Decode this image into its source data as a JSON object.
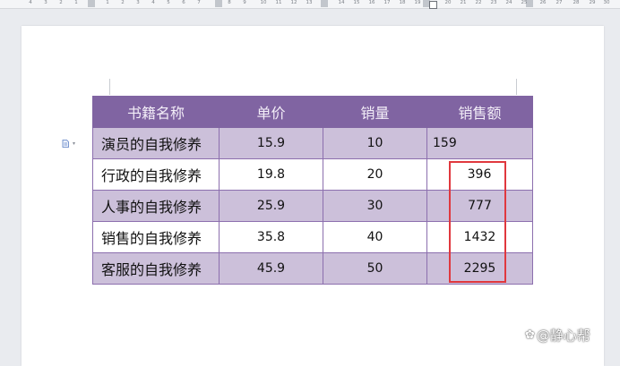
{
  "ruler": {
    "numbers": [
      "4",
      "3",
      "2",
      "1",
      "1",
      "2",
      "3",
      "4",
      "5",
      "6",
      "7",
      "8",
      "9",
      "10",
      "11",
      "12",
      "13",
      "14",
      "15",
      "16",
      "17",
      "18",
      "19",
      "20",
      "21",
      "22",
      "23",
      "24",
      "25",
      "26",
      "27",
      "28",
      "29",
      "30",
      "31",
      "32"
    ]
  },
  "table": {
    "headers": [
      "书籍名称",
      "单价",
      "销量",
      "销售额"
    ],
    "rows": [
      {
        "name": "演员的自我修养",
        "price": "15.9",
        "qty": "10",
        "amount": "159"
      },
      {
        "name": "行政的自我修养",
        "price": "19.8",
        "qty": "20",
        "amount": "396"
      },
      {
        "name": "人事的自我修养",
        "price": "25.9",
        "qty": "30",
        "amount": "777"
      },
      {
        "name": "销售的自我修养",
        "price": "35.8",
        "qty": "40",
        "amount": "1432"
      },
      {
        "name": "客服的自我修养",
        "price": "45.9",
        "qty": "50",
        "amount": "2295"
      }
    ]
  },
  "watermark": {
    "text": "@静心帮",
    "icon": "flower-icon"
  },
  "colors": {
    "header": "#8064a2",
    "band": "#ccc0da",
    "highlight": "#e0383e"
  }
}
